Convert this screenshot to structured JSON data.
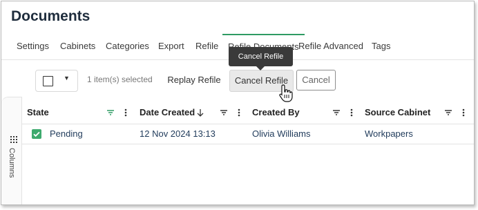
{
  "page": {
    "title": "Documents"
  },
  "tabs": [
    {
      "label": "Settings"
    },
    {
      "label": "Cabinets"
    },
    {
      "label": "Categories"
    },
    {
      "label": "Export"
    },
    {
      "label": "Refile"
    },
    {
      "label": "Refile Documents",
      "active": true
    },
    {
      "label": "Refile Advanced"
    },
    {
      "label": "Tags"
    }
  ],
  "tooltip": {
    "text": "Cancel Refile"
  },
  "toolbar": {
    "selection_count": "1 item(s) selected",
    "replay_label": "Replay Refile",
    "cancel_refile_label": "Cancel Refile",
    "cancel_label": "Cancel"
  },
  "side_panel": {
    "label": "Columns"
  },
  "grid": {
    "columns": [
      {
        "label": "State"
      },
      {
        "label": "Date Created",
        "sort": "descending"
      },
      {
        "label": "Created By"
      },
      {
        "label": "Source Cabinet"
      }
    ],
    "rows": [
      {
        "checked": true,
        "state": "Pending",
        "date_created": "12 Nov 2024 13:13",
        "created_by": "Olivia Williams",
        "source_cabinet": "Workpapers"
      }
    ]
  },
  "colors": {
    "accent": "#2e9b63",
    "checkbox": "#3eaa6e",
    "tooltip_bg": "#3a3a3a"
  },
  "icons": [
    "chevron-down-icon",
    "filter-icon",
    "more-vertical-icon",
    "sort-down-icon",
    "columns-icon",
    "hand-cursor-icon",
    "check-icon"
  ]
}
